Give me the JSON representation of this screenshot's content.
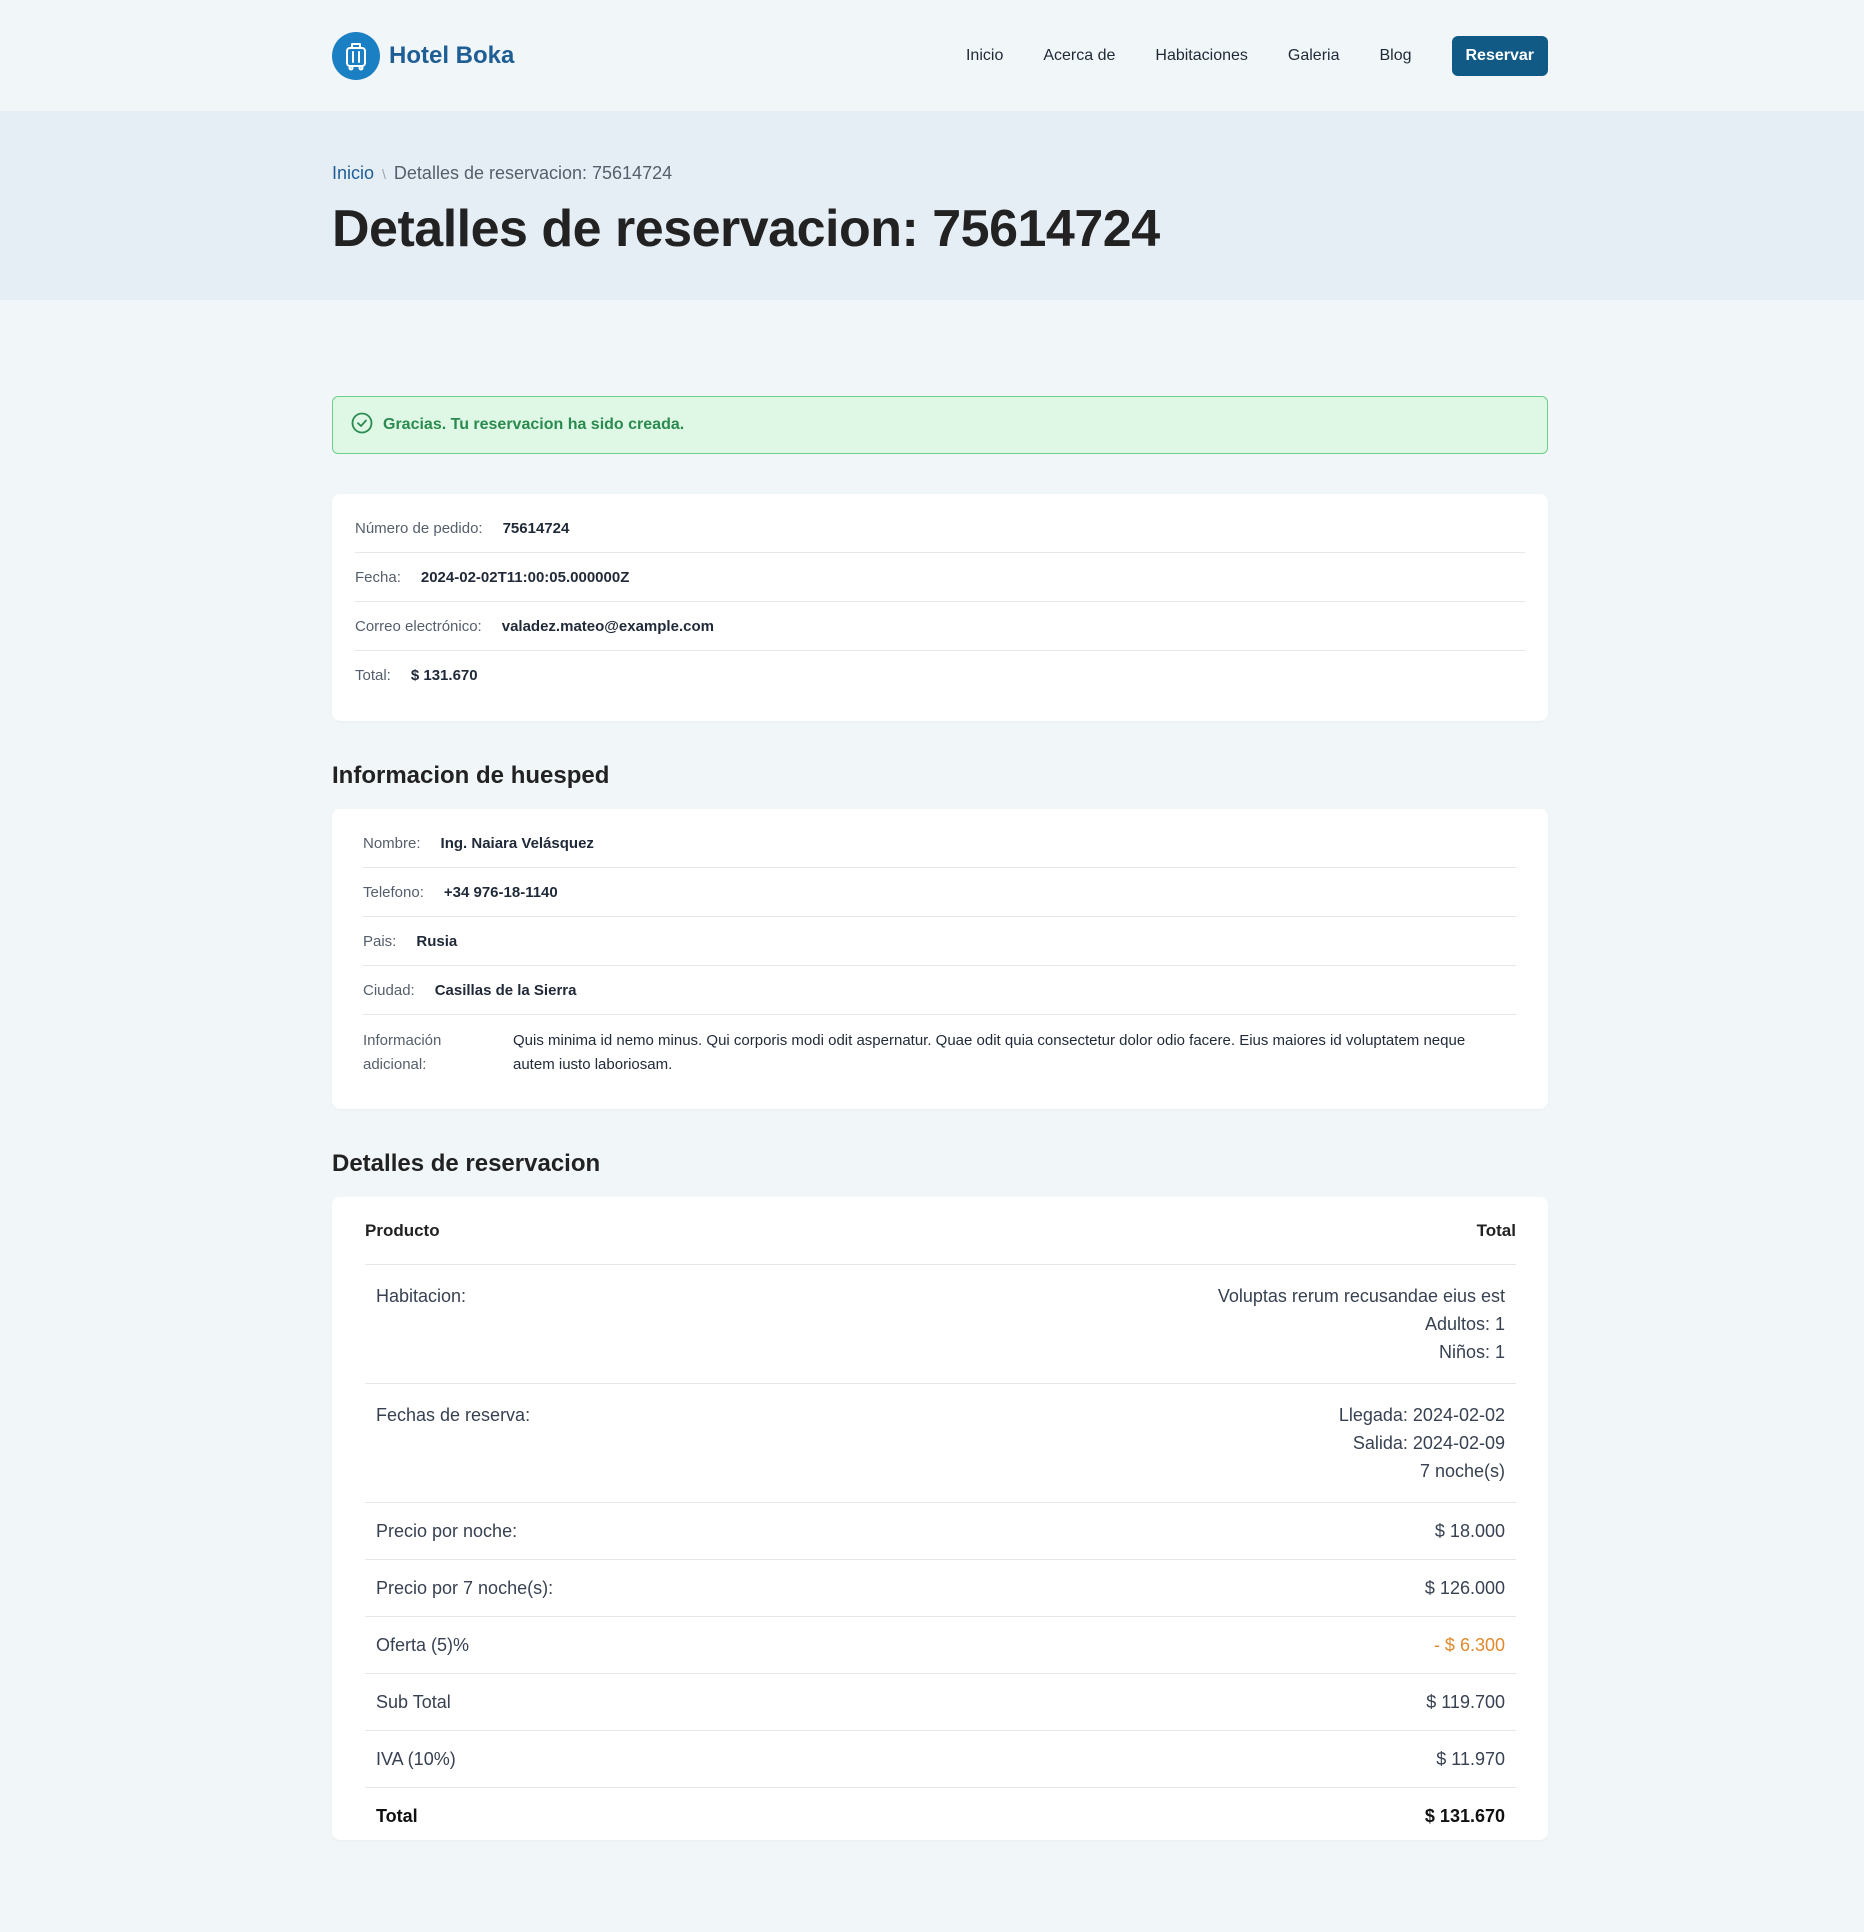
{
  "header": {
    "brand": "Hotel Boka",
    "nav": [
      "Inicio",
      "Acerca de",
      "Habitaciones",
      "Galeria",
      "Blog"
    ],
    "cta": "Reservar"
  },
  "banner": {
    "breadcrumb_home": "Inicio",
    "breadcrumb_sep": "\\",
    "breadcrumb_current": "Detalles de reservacion: 75614724",
    "title": "Detalles de reservacion: 75614724"
  },
  "alert": {
    "text": "Gracias. Tu reservacion ha sido creada."
  },
  "order": {
    "number_label": "Número de pedido:",
    "number_value": "75614724",
    "date_label": "Fecha:",
    "date_value": "2024-02-02T11:00:05.000000Z",
    "email_label": "Correo electrónico:",
    "email_value": "valadez.mateo@example.com",
    "total_label": "Total:",
    "total_value": "$ 131.670"
  },
  "guest": {
    "section_title": "Informacion de huesped",
    "name_label": "Nombre:",
    "name_value": "Ing. Naiara Velásquez",
    "phone_label": "Telefono:",
    "phone_value": "+34 976-18-1140",
    "country_label": "Pais:",
    "country_value": "Rusia",
    "city_label": "Ciudad:",
    "city_value": "Casillas de la Sierra",
    "extra_label": "Información adicional:",
    "extra_value": "Quis minima id nemo minus. Qui corporis modi odit aspernatur. Quae odit quia consectetur dolor odio facere. Eius maiores id voluptatem neque autem iusto laboriosam."
  },
  "reservation": {
    "section_title": "Detalles de reservacion",
    "col_product": "Producto",
    "col_total": "Total",
    "room_label": "Habitacion:",
    "room_name": "Voluptas rerum recusandae eius est",
    "room_adults": "Adultos: 1",
    "room_children": "Niños: 1",
    "dates_label": "Fechas de reserva:",
    "arrival": "Llegada: 2024-02-02",
    "departure": "Salida: 2024-02-09",
    "nights": "7 noche(s)",
    "price_night_label": "Precio por noche:",
    "price_night_value": "$ 18.000",
    "price_total_nights_label": "Precio por 7 noche(s):",
    "price_total_nights_value": "$ 126.000",
    "offer_label": "Oferta (5)%",
    "offer_value": "- $ 6.300",
    "subtotal_label": "Sub Total",
    "subtotal_value": "$ 119.700",
    "tax_label": "IVA (10%)",
    "tax_value": "$ 11.970",
    "total_label": "Total",
    "total_value": "$ 131.670"
  },
  "colors": {
    "brand": "#1f5e95",
    "cta": "#115a86",
    "success_bg": "#dff8e6",
    "success_text": "#2b8a4f",
    "discount": "#e0892f"
  },
  "icons": {
    "logo": "luggage-icon",
    "alert": "check-circle-icon"
  }
}
